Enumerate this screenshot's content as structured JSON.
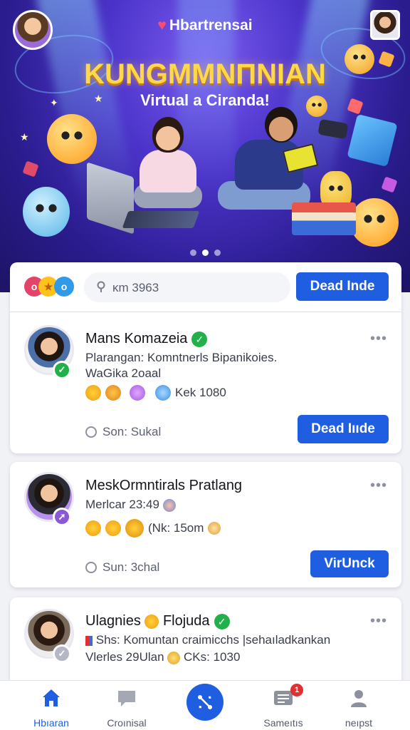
{
  "hero": {
    "brand": "Hbartrensai",
    "headline": "KUNGMMNПNIAN",
    "subline": "Virtual a Ciranda!",
    "carousel_pages": 3,
    "carousel_active": 1
  },
  "search": {
    "value": "ᴋm 3963",
    "button_label": "Dead Inde"
  },
  "posts": [
    {
      "name": "Mans Komazeia",
      "verified": true,
      "text_line1": "Plarangan: Komntnerls Bipanikoies.",
      "text_line2": "WaGika 2oaal",
      "reactions_text": "Kek 1080",
      "meta": "Son: Sukal",
      "button_label": "Dead Iııde",
      "badge": "✓",
      "badge_color": "#22b04a",
      "avatar_bg": "#f0f0f4"
    },
    {
      "name": "MeskOrmntirals Pratlang",
      "verified": false,
      "text_line1": "Merlcar 23:49",
      "text_line2": "",
      "reactions_text": "(Nk: 15om",
      "meta": "Sun: 3chal",
      "button_label": "VirUnck",
      "badge": "➚",
      "badge_color": "#8a5ad6",
      "avatar_bg": "#b891ee"
    },
    {
      "name": "Ulagnies",
      "name_suffix": "Flojuda",
      "verified": true,
      "text_line1": "Shs: Komuntan craimicchs |sehaıladkankan",
      "text_line2": "Vlerles 29Ulan",
      "reactions_text": "CKs: 1030",
      "badge": "✓",
      "badge_color": "#b5b8c4",
      "avatar_bg": "#eeeef2"
    }
  ],
  "nav": [
    {
      "label": "Hbıaran",
      "icon": "home-icon",
      "active": true
    },
    {
      "label": "Croınisal",
      "icon": "chat-icon",
      "active": false
    },
    {
      "label": "",
      "icon": "share-icon",
      "active": false
    },
    {
      "label": "Sameıtıs",
      "icon": "messages-icon",
      "active": false,
      "badge": "1"
    },
    {
      "label": "neıpst",
      "icon": "profile-icon",
      "active": false
    }
  ],
  "colors": {
    "accent": "#1f5ee0",
    "verified": "#22b04a",
    "hero_dark": "#2a1c8e"
  }
}
